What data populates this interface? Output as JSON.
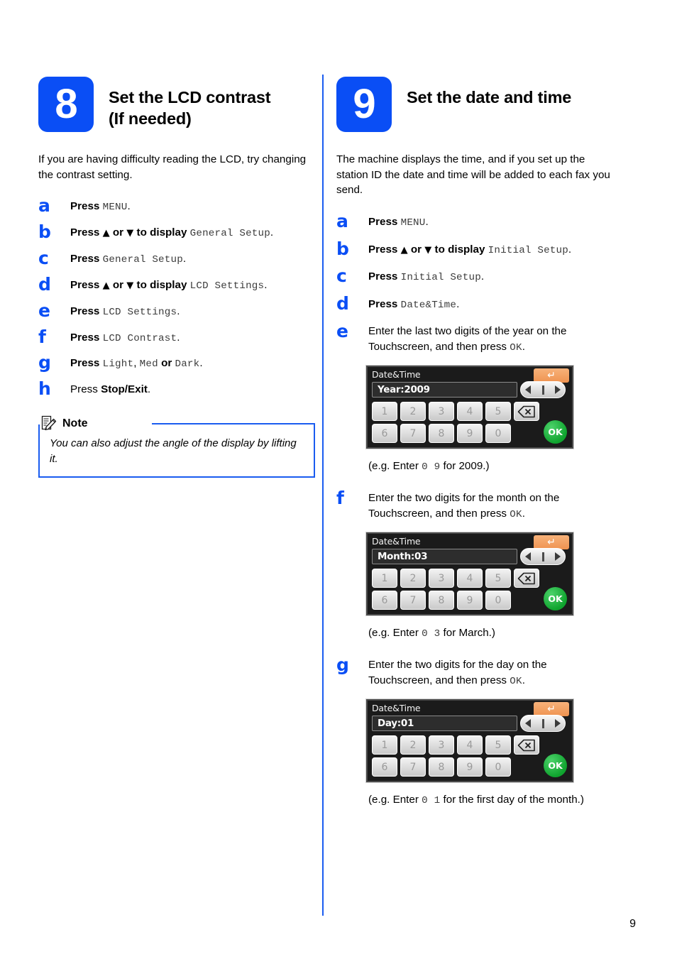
{
  "page": {
    "number": "9"
  },
  "left_section": {
    "badge_number": "8",
    "title_line1": "Set the LCD contrast",
    "title_line2": "(If needed)",
    "intro": "If you are having difficulty reading the LCD, try changing the contrast setting.",
    "steps": [
      {
        "letter": "a",
        "press": "Press",
        "mono1": "MENU",
        "tail": "."
      },
      {
        "letter": "b",
        "press": "Press",
        "mid": "or",
        "tail2": "to display",
        "mono1": "General Setup",
        "tail": "."
      },
      {
        "letter": "c",
        "press": "Press",
        "mono1": "General Setup",
        "tail": "."
      },
      {
        "letter": "d",
        "press": "Press",
        "mid": "or",
        "tail2": "to display",
        "mono1": "LCD Settings",
        "tail": "."
      },
      {
        "letter": "e",
        "press": "Press",
        "mono1": "LCD Settings",
        "tail": "."
      },
      {
        "letter": "f",
        "press": "Press",
        "mono1": "LCD Contrast",
        "tail": "."
      },
      {
        "letter": "g",
        "press": "Press",
        "mono1": "Light",
        "sep1": ",",
        "mono2": "Med",
        "conj": "or",
        "mono3": "Dark",
        "tail": "."
      },
      {
        "letter": "h",
        "press": "Press",
        "bold1": "Stop/Exit",
        "tail": "."
      }
    ],
    "note": {
      "label": "Note",
      "icon": "note-pencil-icon",
      "text": "You can also adjust the angle of the display by lifting it."
    }
  },
  "right_section": {
    "badge_number": "9",
    "title_line1": "Set the date and time",
    "intro": "The machine displays the time, and if you set up the station ID the date and time will be added to each fax you send.",
    "steps": [
      {
        "letter": "a",
        "press": "Press",
        "mono1": "MENU",
        "tail": "."
      },
      {
        "letter": "b",
        "press": "Press",
        "mid": "or",
        "tail2": "to display",
        "mono1": "Initial Setup",
        "tail": "."
      },
      {
        "letter": "c",
        "press": "Press",
        "mono1": "Initial Setup",
        "tail": "."
      },
      {
        "letter": "d",
        "press": "Press",
        "mono1": "Date&Time",
        "tail": "."
      },
      {
        "letter": "e",
        "text_pre": "Enter the last two digits of the year on the Touchscreen, and then press",
        "mono1": "OK",
        "tail": "."
      },
      {
        "letter": "f",
        "text_pre": "Enter the two digits for the month on the Touchscreen, and then press",
        "mono1": "OK",
        "tail": "."
      },
      {
        "letter": "g",
        "text_pre": "Enter the two digits for the day on the Touchscreen, and then press",
        "mono1": "OK",
        "tail": "."
      }
    ],
    "examples": [
      {
        "pre": "(e.g. Enter",
        "mono": "0 9",
        "post": "for 2009.)"
      },
      {
        "pre": "(e.g. Enter",
        "mono": "0 3",
        "post": "for March.)"
      },
      {
        "pre": "(e.g. Enter",
        "mono": "0 1",
        "post": "for the first day of the month.)"
      }
    ],
    "lcd_screens": [
      {
        "title": "Date&Time",
        "value": "Year:2009",
        "back_icon": "back-arrow-icon",
        "keys_row1": [
          "1",
          "2",
          "3",
          "4",
          "5"
        ],
        "keys_row2": [
          "6",
          "7",
          "8",
          "9",
          "0"
        ],
        "backspace_icon": "backspace-icon",
        "ok_label": "OK",
        "nav_left_icon": "nav-left-icon",
        "nav_right_icon": "nav-right-icon"
      },
      {
        "title": "Date&Time",
        "value": "Month:03",
        "back_icon": "back-arrow-icon",
        "keys_row1": [
          "1",
          "2",
          "3",
          "4",
          "5"
        ],
        "keys_row2": [
          "6",
          "7",
          "8",
          "9",
          "0"
        ],
        "backspace_icon": "backspace-icon",
        "ok_label": "OK",
        "nav_left_icon": "nav-left-icon",
        "nav_right_icon": "nav-right-icon"
      },
      {
        "title": "Date&Time",
        "value": "Day:01",
        "back_icon": "back-arrow-icon",
        "keys_row1": [
          "1",
          "2",
          "3",
          "4",
          "5"
        ],
        "keys_row2": [
          "6",
          "7",
          "8",
          "9",
          "0"
        ],
        "backspace_icon": "backspace-icon",
        "ok_label": "OK",
        "nav_left_icon": "nav-left-icon",
        "nav_right_icon": "nav-right-icon"
      }
    ]
  },
  "colors": {
    "brand_blue": "#0a4ef5",
    "note_border": "#1a5cf0",
    "lcd_back_orange": "#ef9350",
    "lcd_ok_green": "#0fa32e",
    "lcd_background": "#1b1b1b"
  }
}
